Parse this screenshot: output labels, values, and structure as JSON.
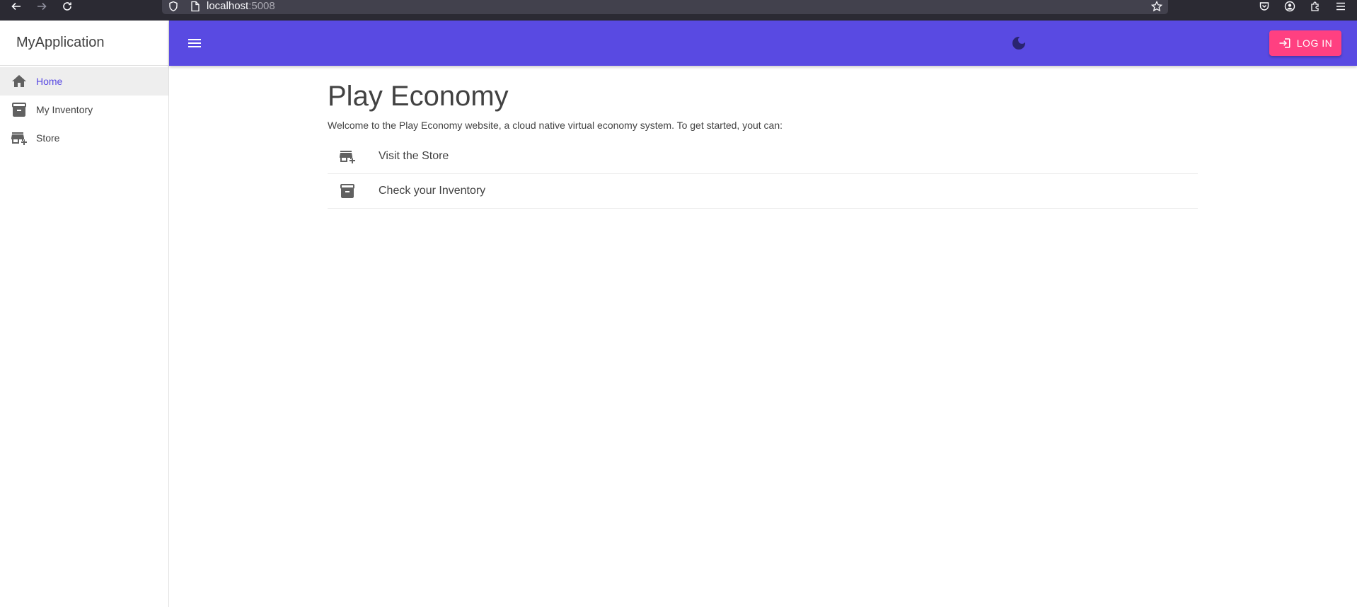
{
  "browser": {
    "url_host": "localhost",
    "url_port": ":5008"
  },
  "drawer": {
    "app_title": "MyApplication",
    "items": [
      {
        "label": "Home",
        "icon": "home-icon",
        "active": true
      },
      {
        "label": "My Inventory",
        "icon": "inventory-box-icon",
        "active": false
      },
      {
        "label": "Store",
        "icon": "store-add-icon",
        "active": false
      }
    ]
  },
  "appbar": {
    "login_label": "LOG IN",
    "color": "#594ae2",
    "login_color": "#ff4081"
  },
  "main": {
    "title": "Play Economy",
    "welcome": "Welcome to the Play Economy website, a cloud native virtual economy system. To get started, yout can:",
    "links": [
      {
        "label": "Visit the Store",
        "icon": "store-add-icon"
      },
      {
        "label": "Check your Inventory",
        "icon": "inventory-box-icon"
      }
    ]
  }
}
